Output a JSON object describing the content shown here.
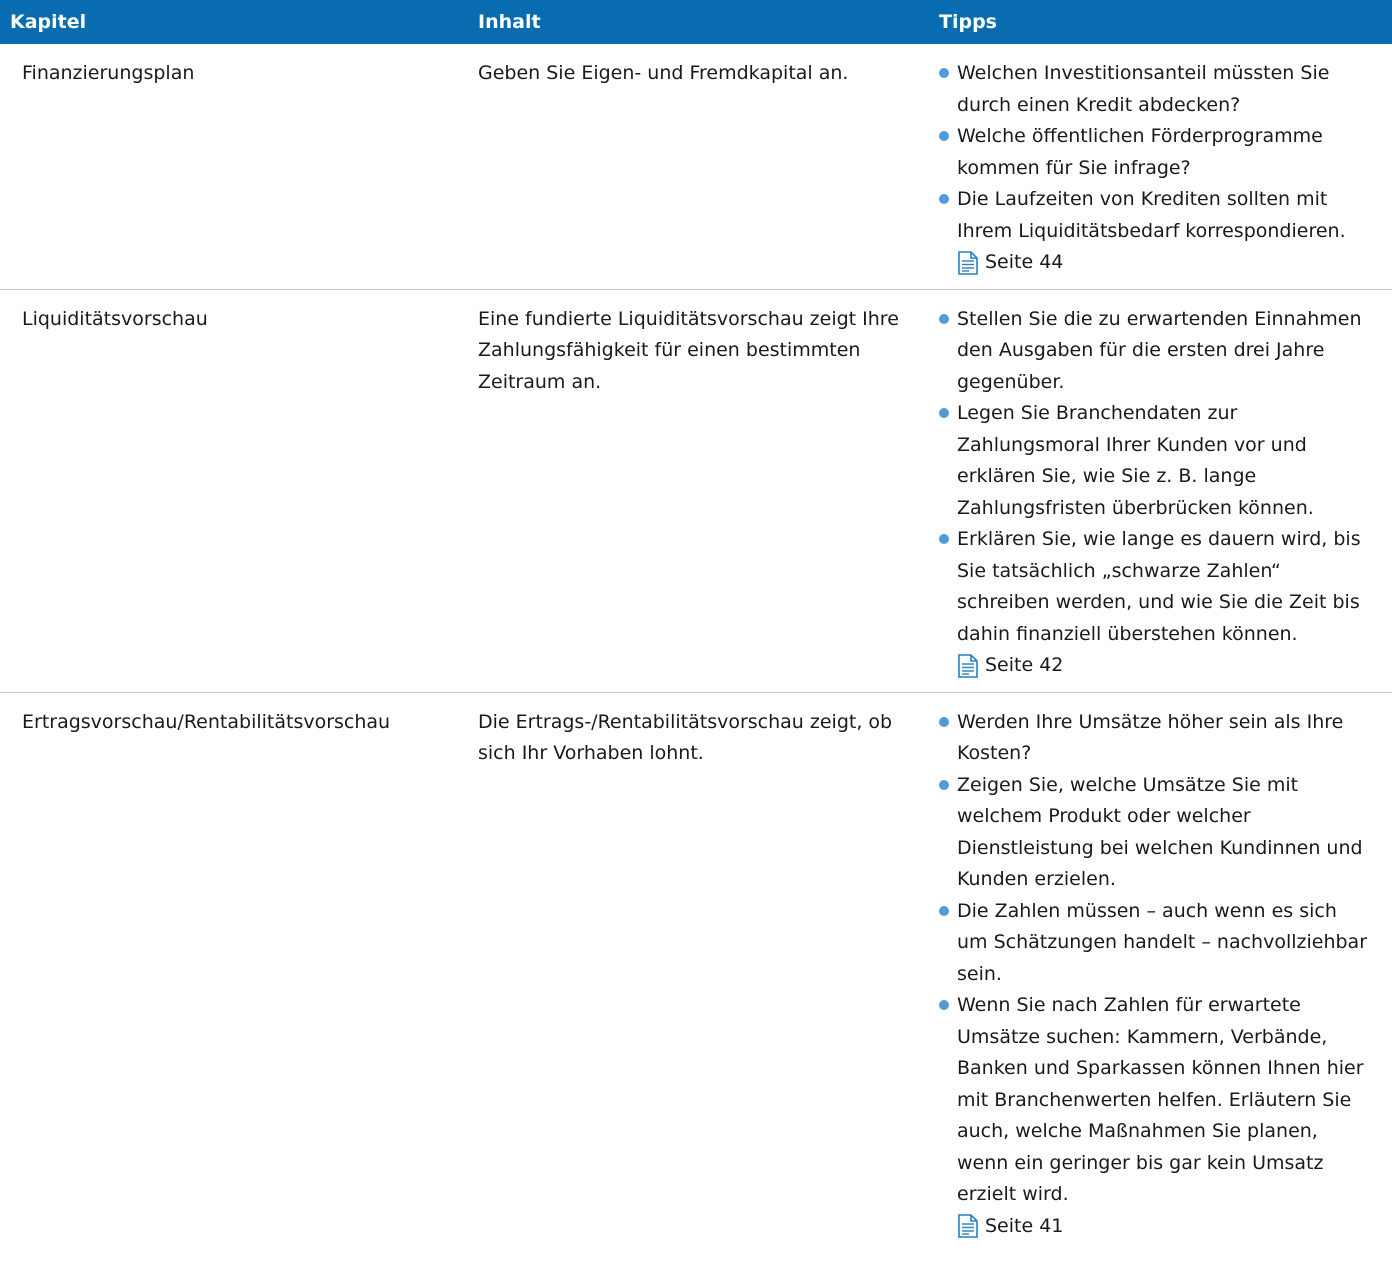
{
  "header": {
    "col1": "Kapitel",
    "col2": "Inhalt",
    "col3": "Tipps"
  },
  "rows": [
    {
      "kapitel": "Finanzierungsplan",
      "inhalt": "Geben Sie Eigen- und Fremdkapital an.",
      "tips": [
        "Welchen Investitionsanteil müssten Sie durch einen Kredit abdecken?",
        "Welche öffentlichen Förderprogramme kommen für Sie infrage?",
        "Die Laufzeiten von Krediten sollten mit Ihrem Liquiditätsbedarf korrespondieren."
      ],
      "page_ref": "Seite 44"
    },
    {
      "kapitel": "Liquiditätsvorschau",
      "inhalt": "Eine fundierte Liquiditätsvorschau zeigt Ihre Zahlungsfähigkeit für einen bestimmten Zeitraum an.",
      "tips": [
        "Stellen Sie die zu erwartenden Einnahmen den Ausgaben für die ersten drei Jahre gegenüber.",
        "Legen Sie Branchendaten zur Zahlungsmoral Ihrer Kunden vor und erklären Sie, wie Sie z. B. lange Zahlungsfristen überbrücken können.",
        "Erklären Sie, wie lange es dauern wird, bis Sie tatsächlich „schwarze Zahlen“ schreiben werden, und wie Sie die Zeit bis dahin finanziell überstehen können."
      ],
      "page_ref": "Seite 42"
    },
    {
      "kapitel": "Ertragsvorschau/Rentabilitätsvorschau",
      "inhalt": "Die Ertrags-/Rentabilitätsvorschau zeigt, ob sich Ihr Vorhaben lohnt.",
      "tips": [
        "Werden Ihre Umsätze höher sein als Ihre Kosten?",
        "Zeigen Sie, welche Umsätze Sie mit welchem Produkt oder welcher Dienstleistung bei welchen Kundinnen und Kunden erzielen.",
        "Die Zahlen müssen – auch wenn es sich um Schätzungen handelt – nachvollziehbar sein.",
        "Wenn Sie nach Zahlen für erwartete Umsätze suchen: Kammern, Verbände, Banken und Sparkassen können Ihnen hier mit Branchenwerten helfen. Erläutern Sie auch, welche Maßnahmen Sie planen, wenn ein geringer bis gar kein Umsatz erzielt wird."
      ],
      "page_ref": "Seite 41"
    }
  ],
  "colors": {
    "header_bg": "#0a6cb0",
    "bullet": "#4f9bd9",
    "icon": "#2a7fc4"
  },
  "icons": {
    "page_reference": "document-icon",
    "bullet": "bullet-dot"
  }
}
